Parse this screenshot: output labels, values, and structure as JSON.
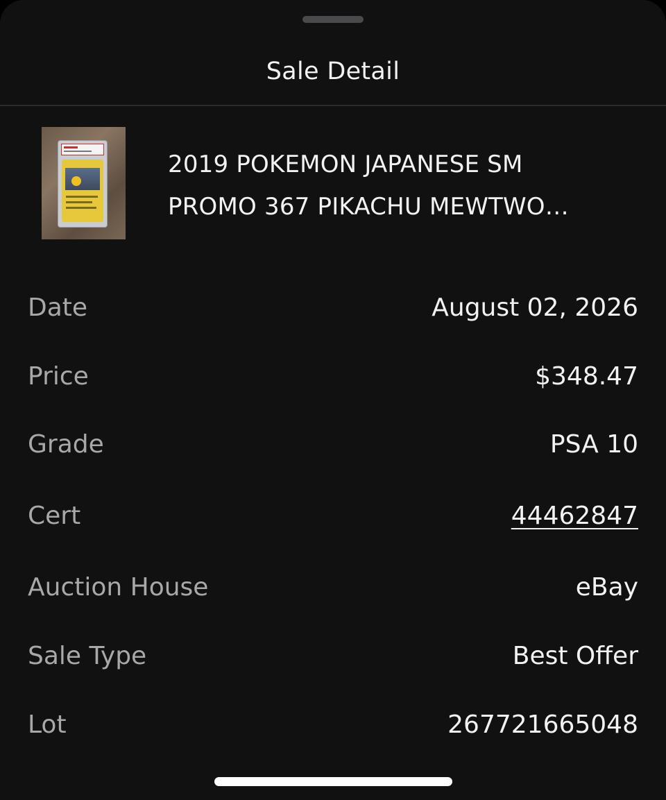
{
  "sheet": {
    "title": "Sale Detail"
  },
  "product": {
    "name_line1": "2019 POKEMON JAPANESE SM",
    "name_line2": "PROMO 367 PIKACHU MEWTWO…",
    "thumbnail_icon": "graded-card-slab-image"
  },
  "details": [
    {
      "label": "Date",
      "value": "August 02, 2026"
    },
    {
      "label": "Price",
      "value": "$348.47"
    },
    {
      "label": "Grade",
      "value": "PSA 10"
    },
    {
      "label": "Cert",
      "value": "44462847"
    },
    {
      "label": "Auction House",
      "value": "eBay"
    },
    {
      "label": "Sale Type",
      "value": "Best Offer"
    },
    {
      "label": "Lot",
      "value": "267721665048"
    }
  ],
  "colors": {
    "background": "#111111",
    "primary_text": "#f2f2f2",
    "secondary_text": "#a8a8a8"
  }
}
